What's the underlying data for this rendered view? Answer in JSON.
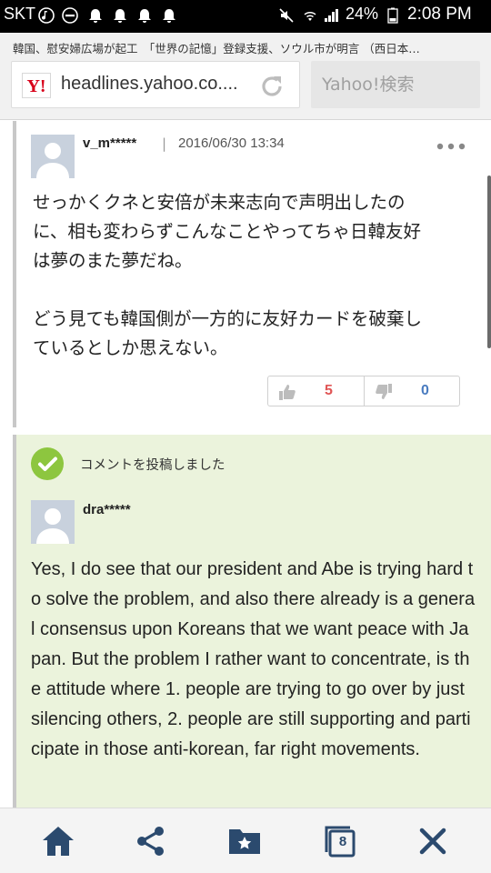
{
  "status_bar": {
    "carrier": "SKT",
    "battery": "24%",
    "time": "2:08 PM"
  },
  "browser": {
    "page_title": "韓国、慰安婦広場が起工　「世界の記憶」登録支援、ソウル市が明言 （西日本…",
    "url": "headlines.yahoo.co....",
    "search_placeholder": "Yahoo!検索",
    "logo_text": "Y!"
  },
  "comments": [
    {
      "username": "v_m*****",
      "separator": "|",
      "timestamp": "2016/06/30 13:34",
      "body": "せっかくクネと安倍が未来志向で声明出したの\nに、相も変わらずこんなことやってちゃ日韓友好\nは夢のまた夢だね。\n\nどう見ても韓国側が一方的に友好カードを破棄し\nているとしか思えない。",
      "likes": "5",
      "dislikes": "0"
    }
  ],
  "posted": {
    "notice": "コメントを投稿しました",
    "username": "dra*****",
    "body": "Yes, I do see that our president and Abe is trying hard to solve the problem, and also there already is a general consensus upon Koreans that we want peace with Japan. But the problem I rather want to concentrate, is the attitude where 1. people are trying to go over by just silencing others, 2. people are still supporting and participate in those anti-korean, far right movements."
  },
  "bottom_nav": {
    "tab_count": "8"
  },
  "colors": {
    "like": "#e05555",
    "dislike": "#4a7cc0",
    "posted_bg": "#ebf3dc",
    "check_green": "#8dc63f",
    "nav_icon": "#2b4a6e"
  }
}
